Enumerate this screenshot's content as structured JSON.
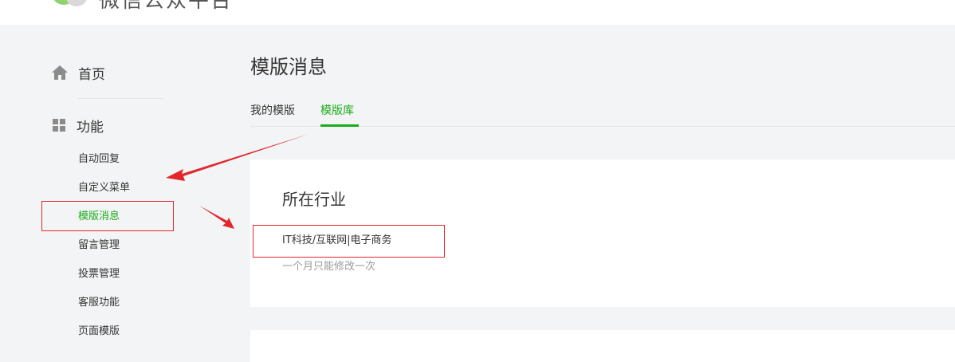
{
  "header": {
    "brand": "微信公众平台",
    "accent_color": "#1aad19"
  },
  "sidebar": {
    "home": {
      "icon": "home-icon",
      "label": "首页"
    },
    "features": {
      "icon": "grid-icon",
      "label": "功能",
      "items": [
        {
          "label": "自动回复"
        },
        {
          "label": "自定义菜单"
        },
        {
          "label": "模版消息",
          "active": true
        },
        {
          "label": "留言管理"
        },
        {
          "label": "投票管理"
        },
        {
          "label": "客服功能"
        },
        {
          "label": "页面模版"
        }
      ]
    }
  },
  "main": {
    "title": "模版消息",
    "tabs": [
      {
        "label": "我的模版"
      },
      {
        "label": "模版库",
        "active": true
      }
    ],
    "industry_card": {
      "title": "所在行业",
      "value": "IT科技/互联网|电子商务",
      "tip": "一个月只能修改一次"
    }
  },
  "annotation_color": "#e2272c"
}
